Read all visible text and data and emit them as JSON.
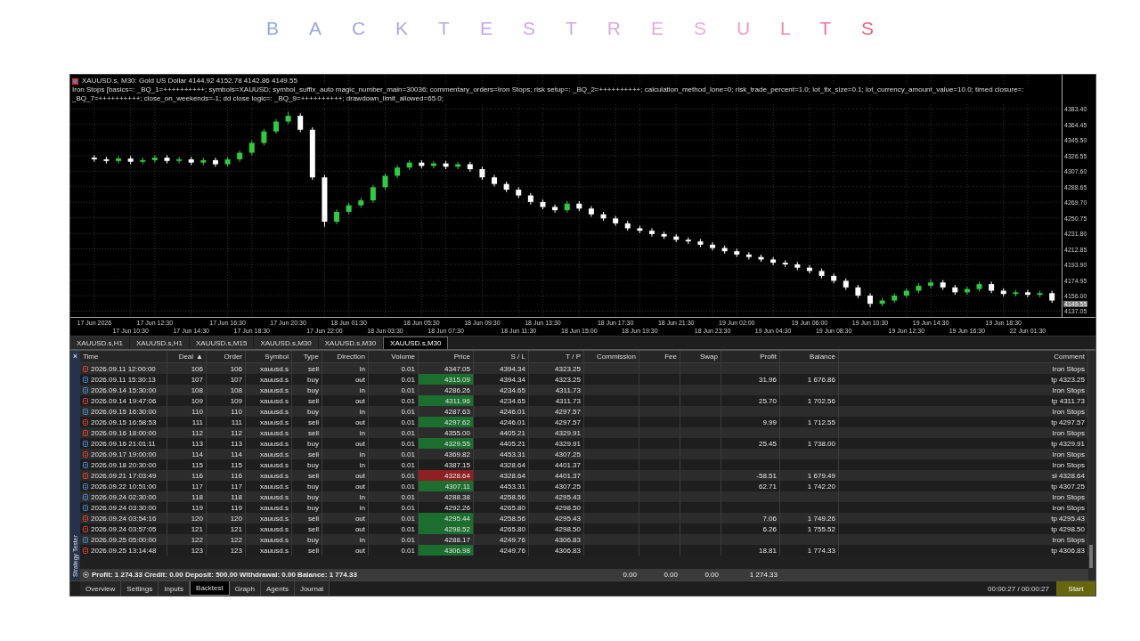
{
  "title": "BACKTESTRESULTS",
  "chart": {
    "symbol_line": "XAUUSD.s, M30:  Gold US Dollar  4144.92 4152.78 4142.86 4149.55",
    "params_line": "Iron Stops [basics=: _BQ_1=++++++++++; symbols=XAUUSD; symbol_suffix_auto magic_number_main=30036; commentary_orders=Iron Stops; risk setup=: _BQ_2=++++++++++; calculation_method_lone=0; risk_trade_percent=1.0; lot_fix_size=0.1; lot_currency_amount_value=10.0; timed closure=: _BQ_7=++++++++++; close_on_weekends=-1; dd close logic=: _BQ_9=++++++++++; drawdown_limit_allowed=65.0;",
    "current_price": "4149.55",
    "chart_data": {
      "type": "candlestick",
      "ylim": [
        4130,
        4425
      ],
      "grid": true,
      "categories": [
        "17 Jun 2026",
        null,
        null,
        "17 Jun 10:30",
        null,
        "17 Jun 12:30",
        null,
        null,
        "17 Jun 14:30",
        null,
        null,
        "17 Jun 16:30",
        null,
        "17 Jun 18:30",
        null,
        null,
        "17 Jun 20:30",
        null,
        null,
        "17 Jun 22:00",
        null,
        "18 Jun 01:30",
        null,
        null,
        "18 Jun 03:30",
        null,
        null,
        "18 Jun 05:30",
        null,
        "18 Jun 07:30",
        null,
        null,
        "18 Jun 09:30",
        null,
        null,
        "18 Jun 11:30",
        null,
        "18 Jun 13:30",
        null,
        null,
        "18 Jun 15:00",
        null,
        null,
        "18 Jun 17:30",
        null,
        "18 Jun 19:30",
        null,
        null,
        "18 Jun 21:30",
        null,
        null,
        "18 Jun 23:30",
        null,
        "19 Jun 02:00",
        null,
        null,
        "19 Jun 04:30",
        null,
        null,
        "19 Jun 06:00",
        null,
        "19 Jun 08:30",
        null,
        null,
        "19 Jun 10:30",
        null,
        null,
        "19 Jun 12:30",
        null,
        "19 Jun 14:30",
        null,
        null,
        "19 Jun 16:30",
        null,
        null,
        "19 Jun 18:30",
        null,
        "22 Jun 01:30",
        null,
        null
      ],
      "ohlc": [
        [
          4324,
          4327,
          4319,
          4322
        ],
        [
          4322,
          4325,
          4317,
          4320
        ],
        [
          4320,
          4326,
          4317,
          4323
        ],
        [
          4323,
          4326,
          4316,
          4319
        ],
        [
          4319,
          4324,
          4316,
          4321
        ],
        [
          4321,
          4327,
          4318,
          4324
        ],
        [
          4324,
          4327,
          4317,
          4320
        ],
        [
          4320,
          4325,
          4317,
          4322
        ],
        [
          4322,
          4325,
          4315,
          4318
        ],
        [
          4318,
          4324,
          4315,
          4321
        ],
        [
          4321,
          4324,
          4313,
          4316
        ],
        [
          4316,
          4325,
          4313,
          4322
        ],
        [
          4322,
          4333,
          4319,
          4330
        ],
        [
          4330,
          4345,
          4327,
          4342
        ],
        [
          4342,
          4359,
          4339,
          4356
        ],
        [
          4356,
          4371,
          4353,
          4368
        ],
        [
          4368,
          4380,
          4365,
          4375
        ],
        [
          4375,
          4378,
          4355,
          4358
        ],
        [
          4358,
          4361,
          4297,
          4300
        ],
        [
          4300,
          4303,
          4240,
          4246
        ],
        [
          4246,
          4261,
          4243,
          4258
        ],
        [
          4258,
          4269,
          4255,
          4266
        ],
        [
          4266,
          4275,
          4263,
          4272
        ],
        [
          4272,
          4291,
          4269,
          4288
        ],
        [
          4288,
          4305,
          4285,
          4302
        ],
        [
          4302,
          4315,
          4299,
          4312
        ],
        [
          4312,
          4321,
          4309,
          4318
        ],
        [
          4318,
          4321,
          4311,
          4314
        ],
        [
          4314,
          4320,
          4311,
          4317
        ],
        [
          4317,
          4320,
          4310,
          4313
        ],
        [
          4313,
          4319,
          4310,
          4316
        ],
        [
          4316,
          4319,
          4307,
          4310
        ],
        [
          4310,
          4313,
          4297,
          4300
        ],
        [
          4300,
          4303,
          4289,
          4292
        ],
        [
          4292,
          4295,
          4282,
          4285
        ],
        [
          4285,
          4288,
          4275,
          4278
        ],
        [
          4278,
          4281,
          4267,
          4270
        ],
        [
          4270,
          4273,
          4261,
          4264
        ],
        [
          4264,
          4267,
          4257,
          4260
        ],
        [
          4260,
          4271,
          4257,
          4268
        ],
        [
          4268,
          4271,
          4259,
          4262
        ],
        [
          4262,
          4265,
          4252,
          4255
        ],
        [
          4255,
          4258,
          4247,
          4250
        ],
        [
          4250,
          4253,
          4241,
          4244
        ],
        [
          4244,
          4247,
          4235,
          4238
        ],
        [
          4238,
          4241,
          4232,
          4235
        ],
        [
          4235,
          4238,
          4228,
          4231
        ],
        [
          4231,
          4234,
          4225,
          4228
        ],
        [
          4228,
          4231,
          4221,
          4224
        ],
        [
          4224,
          4227,
          4219,
          4222
        ],
        [
          4222,
          4225,
          4215,
          4218
        ],
        [
          4218,
          4221,
          4211,
          4214
        ],
        [
          4214,
          4217,
          4207,
          4210
        ],
        [
          4210,
          4213,
          4203,
          4206
        ],
        [
          4206,
          4209,
          4200,
          4203
        ],
        [
          4203,
          4206,
          4197,
          4200
        ],
        [
          4200,
          4203,
          4193,
          4196
        ],
        [
          4196,
          4199,
          4191,
          4194
        ],
        [
          4194,
          4197,
          4187,
          4190
        ],
        [
          4190,
          4193,
          4183,
          4186
        ],
        [
          4186,
          4189,
          4177,
          4180
        ],
        [
          4180,
          4183,
          4171,
          4174
        ],
        [
          4174,
          4177,
          4163,
          4166
        ],
        [
          4166,
          4169,
          4153,
          4156
        ],
        [
          4156,
          4159,
          4142,
          4146
        ],
        [
          4146,
          4153,
          4143,
          4150
        ],
        [
          4150,
          4159,
          4147,
          4156
        ],
        [
          4156,
          4165,
          4153,
          4162
        ],
        [
          4162,
          4171,
          4159,
          4168
        ],
        [
          4168,
          4176,
          4165,
          4172
        ],
        [
          4172,
          4175,
          4163,
          4166
        ],
        [
          4166,
          4169,
          4157,
          4160
        ],
        [
          4160,
          4167,
          4157,
          4164
        ],
        [
          4164,
          4173,
          4161,
          4170
        ],
        [
          4170,
          4173,
          4159,
          4162
        ],
        [
          4162,
          4165,
          4155,
          4158
        ],
        [
          4158,
          4163,
          4155,
          4160
        ],
        [
          4160,
          4163,
          4154,
          4157
        ],
        [
          4157,
          4162,
          4154,
          4159
        ],
        [
          4159,
          4162,
          4147,
          4150
        ]
      ],
      "yticks": [
        {
          "value": 4383.4,
          "label": "4383.40"
        },
        {
          "value": 4364.45,
          "label": "4364.45"
        },
        {
          "value": 4345.5,
          "label": "4345.50"
        },
        {
          "value": 4326.55,
          "label": "4326.55"
        },
        {
          "value": 4307.6,
          "label": "4307.60"
        },
        {
          "value": 4288.65,
          "label": "4288.65"
        },
        {
          "value": 4269.7,
          "label": "4269.70"
        },
        {
          "value": 4250.75,
          "label": "4250.75"
        },
        {
          "value": 4231.8,
          "label": "4231.80"
        },
        {
          "value": 4212.85,
          "label": "4212.85"
        },
        {
          "value": 4193.9,
          "label": "4193.90"
        },
        {
          "value": 4174.95,
          "label": "4174.95"
        },
        {
          "value": 4156,
          "label": "4156.00"
        },
        {
          "value": 4137.05,
          "label": "4137.05"
        }
      ]
    }
  },
  "chart_tabs": [
    {
      "label": "XAUUSD.s,H1",
      "selected": false
    },
    {
      "label": "XAUUSD.s,H1",
      "selected": false
    },
    {
      "label": "XAUUSD.s,M15",
      "selected": false
    },
    {
      "label": "XAUUSD.s,M30",
      "selected": false
    },
    {
      "label": "XAUUSD.s,M30",
      "selected": false
    },
    {
      "label": "XAUUSD.s,M30",
      "selected": true
    }
  ],
  "side_label": "Strategy Tester",
  "close_glyph": "×",
  "table": {
    "columns": [
      "Time",
      "Deal",
      "Order",
      "Symbol",
      "Type",
      "Direction",
      "Volume",
      "Price",
      "S / L",
      "T / P",
      "Commission",
      "Fee",
      "Swap",
      "Profit",
      "Balance",
      "Comment"
    ],
    "sort_glyph": "▲",
    "rows": [
      {
        "kind": "sell",
        "time": "2026.09.11 12:00:00",
        "deal": "106",
        "order": "106",
        "symbol": "xauusd.s",
        "type": "sell",
        "direction": "in",
        "volume": "0.01",
        "price": "4347.05",
        "sl": "4394.34",
        "tp": "4323.25",
        "comment": "Iron Stops"
      },
      {
        "kind": "buy",
        "color": "#1b6e2e",
        "time": "2026.09.11 15:30:13",
        "deal": "107",
        "order": "107",
        "symbol": "xauusd.s",
        "type": "buy",
        "direction": "out",
        "volume": "0.01",
        "price": "4315.09",
        "sl": "4394.34",
        "tp": "4323.25",
        "profit": "31.96",
        "balance": "1 676.86",
        "comment": "tp 4323.25"
      },
      {
        "kind": "buy",
        "time": "2026.09.14 15:30:00",
        "deal": "108",
        "order": "108",
        "symbol": "xauusd.s",
        "type": "buy",
        "direction": "in",
        "volume": "0.01",
        "price": "4286.26",
        "sl": "4234.65",
        "tp": "4311.73",
        "comment": "Iron Stops"
      },
      {
        "kind": "sell",
        "color": "#1b6e2e",
        "time": "2026.09.14 19:47:06",
        "deal": "109",
        "order": "109",
        "symbol": "xauusd.s",
        "type": "sell",
        "direction": "out",
        "volume": "0.01",
        "price": "4311.96",
        "sl": "4234.65",
        "tp": "4311.73",
        "profit": "25.70",
        "balance": "1 702.56",
        "comment": "tp 4311.73"
      },
      {
        "kind": "buy",
        "time": "2026.09.15 16:30:00",
        "deal": "110",
        "order": "110",
        "symbol": "xauusd.s",
        "type": "buy",
        "direction": "in",
        "volume": "0.01",
        "price": "4287.63",
        "sl": "4246.01",
        "tp": "4297.57",
        "comment": "Iron Stops"
      },
      {
        "kind": "sell",
        "color": "#1b6e2e",
        "time": "2026.09.15 16:58:53",
        "deal": "111",
        "order": "111",
        "symbol": "xauusd.s",
        "type": "sell",
        "direction": "out",
        "volume": "0.01",
        "price": "4297.62",
        "sl": "4246.01",
        "tp": "4297.57",
        "profit": "9.99",
        "balance": "1 712.55",
        "comment": "tp 4297.57"
      },
      {
        "kind": "sell",
        "time": "2026.09.16 18:00:00",
        "deal": "112",
        "order": "112",
        "symbol": "xauusd.s",
        "type": "sell",
        "direction": "in",
        "volume": "0.01",
        "price": "4355.00",
        "sl": "4405.21",
        "tp": "4329.91",
        "comment": "Iron Stops"
      },
      {
        "kind": "buy",
        "color": "#1b6e2e",
        "time": "2026.09.16 21:01:11",
        "deal": "113",
        "order": "113",
        "symbol": "xauusd.s",
        "type": "buy",
        "direction": "out",
        "volume": "0.01",
        "price": "4329.55",
        "sl": "4405.21",
        "tp": "4329.91",
        "profit": "25.45",
        "balance": "1 738.00",
        "comment": "tp 4329.91"
      },
      {
        "kind": "sell",
        "time": "2026.09.17 19:00:00",
        "deal": "114",
        "order": "114",
        "symbol": "xauusd.s",
        "type": "sell",
        "direction": "in",
        "volume": "0.01",
        "price": "4369.82",
        "sl": "4453.31",
        "tp": "4307.25",
        "comment": "Iron Stops"
      },
      {
        "kind": "buy",
        "time": "2026.09.18 20:30:00",
        "deal": "115",
        "order": "115",
        "symbol": "xauusd.s",
        "type": "buy",
        "direction": "in",
        "volume": "0.01",
        "price": "4387.15",
        "sl": "4328.64",
        "tp": "4401.37",
        "comment": "Iron Stops"
      },
      {
        "kind": "sell",
        "color": "#8e1f22",
        "time": "2026.09.21 17:03:49",
        "deal": "116",
        "order": "116",
        "symbol": "xauusd.s",
        "type": "sell",
        "direction": "out",
        "volume": "0.01",
        "price": "4328.64",
        "sl": "4328.64",
        "tp": "4401.37",
        "profit": "-58.51",
        "balance": "1 679.49",
        "comment": "sl 4328.64"
      },
      {
        "kind": "buy",
        "color": "#1b6e2e",
        "time": "2026.09.22 10:51:00",
        "deal": "117",
        "order": "117",
        "symbol": "xauusd.s",
        "type": "buy",
        "direction": "out",
        "volume": "0.01",
        "price": "4307.11",
        "sl": "4453.31",
        "tp": "4307.25",
        "profit": "62.71",
        "balance": "1 742.20",
        "comment": "tp 4307.25"
      },
      {
        "kind": "buy",
        "time": "2026.09.24 02:30:00",
        "deal": "118",
        "order": "118",
        "symbol": "xauusd.s",
        "type": "buy",
        "direction": "in",
        "volume": "0.01",
        "price": "4288.38",
        "sl": "4258.56",
        "tp": "4295.43",
        "comment": "Iron Stops"
      },
      {
        "kind": "buy",
        "time": "2026.09.24 03:30:00",
        "deal": "119",
        "order": "119",
        "symbol": "xauusd.s",
        "type": "buy",
        "direction": "in",
        "volume": "0.01",
        "price": "4292.26",
        "sl": "4265.80",
        "tp": "4298.50",
        "comment": "Iron Stops"
      },
      {
        "kind": "sell",
        "color": "#1b6e2e",
        "time": "2026.09.24 03:54:16",
        "deal": "120",
        "order": "120",
        "symbol": "xauusd.s",
        "type": "sell",
        "direction": "out",
        "volume": "0.01",
        "price": "4295.44",
        "sl": "4258.56",
        "tp": "4295.43",
        "profit": "7.06",
        "balance": "1 749.26",
        "comment": "tp 4295.43"
      },
      {
        "kind": "sell",
        "color": "#1b6e2e",
        "time": "2026.09.24 03:57:05",
        "deal": "121",
        "order": "121",
        "symbol": "xauusd.s",
        "type": "sell",
        "direction": "out",
        "volume": "0.01",
        "price": "4298.52",
        "sl": "4265.80",
        "tp": "4298.50",
        "profit": "6.26",
        "balance": "1 755.52",
        "comment": "tp 4298.50"
      },
      {
        "kind": "buy",
        "time": "2026.09.25 05:00:00",
        "deal": "122",
        "order": "122",
        "symbol": "xauusd.s",
        "type": "buy",
        "direction": "in",
        "volume": "0.01",
        "price": "4288.17",
        "sl": "4249.76",
        "tp": "4306.83",
        "comment": "Iron Stops"
      },
      {
        "kind": "sell",
        "color": "#1b6e2e",
        "time": "2026.09.25 13:14:48",
        "deal": "123",
        "order": "123",
        "symbol": "xauusd.s",
        "type": "sell",
        "direction": "out",
        "volume": "0.01",
        "price": "4306.98",
        "sl": "4249.76",
        "tp": "4306.83",
        "profit": "18.81",
        "balance": "1 774.33",
        "comment": "tp 4306.83"
      }
    ],
    "summary": "Profit: 1 274.33  Credit: 0.00  Deposit: 500.00  Withdrawal: 0.00  Balance: 1 774.33",
    "totals": {
      "commission": "0.00",
      "fee": "0.00",
      "swap": "0.00",
      "profit": "1 274.33"
    }
  },
  "bottom_tabs": [
    {
      "label": "Overview",
      "selected": false
    },
    {
      "label": "Settings",
      "selected": false
    },
    {
      "label": "Inputs",
      "selected": false
    },
    {
      "label": "Backtest",
      "selected": true
    },
    {
      "label": "Graph",
      "selected": false
    },
    {
      "label": "Agents",
      "selected": false
    },
    {
      "label": "Journal",
      "selected": false
    }
  ],
  "elapsed": "00:00:27 / 00:00:27",
  "start_button": "Start"
}
